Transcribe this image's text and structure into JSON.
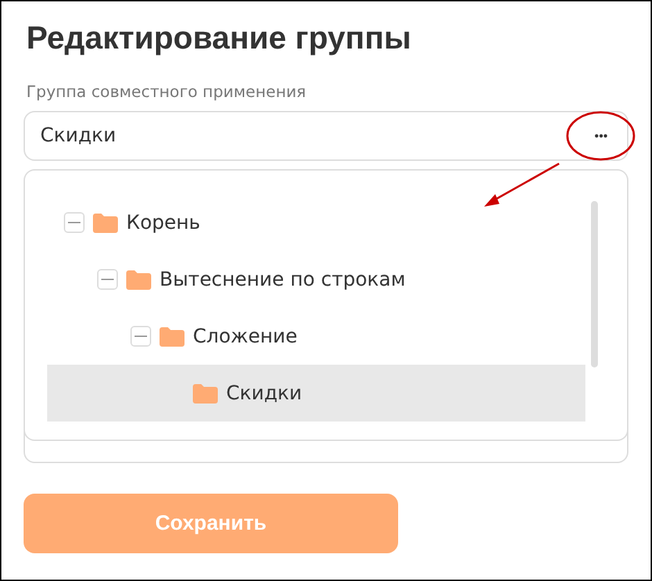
{
  "title": "Редактирование группы",
  "field": {
    "label": "Группа совместного применения",
    "value": "Скидки",
    "more_button": "•••"
  },
  "tree": [
    {
      "label": "Корень",
      "expanded": true,
      "selected": false,
      "children": [
        {
          "label": "Вытеснение по строкам",
          "expanded": true,
          "selected": false,
          "children": [
            {
              "label": "Сложение",
              "expanded": true,
              "selected": false,
              "children": [
                {
                  "label": "Скидки",
                  "selected": true
                }
              ]
            }
          ]
        }
      ]
    }
  ],
  "save_button": "Сохранить"
}
